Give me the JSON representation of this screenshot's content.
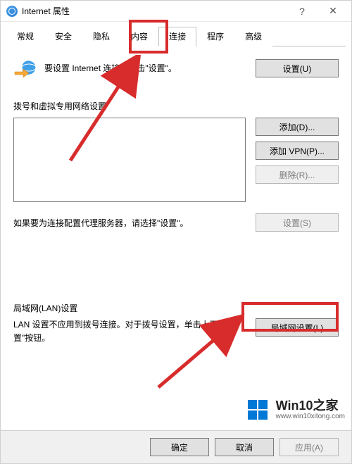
{
  "window": {
    "title": "Internet 属性",
    "help_label": "?",
    "close_label": "✕"
  },
  "tabs": {
    "items": [
      "常规",
      "安全",
      "隐私",
      "内容",
      "连接",
      "程序",
      "高级"
    ],
    "active_index": 4
  },
  "top": {
    "desc_pre": "要设置 Internet 连接，单击",
    "desc_quoted": "\"设置\"",
    "desc_post": "。",
    "settings_btn": "设置(U)"
  },
  "dial": {
    "title": "拨号和虚拟专用网络设置",
    "add_btn": "添加(D)...",
    "add_vpn_btn": "添加 VPN(P)...",
    "remove_btn": "删除(R)...",
    "proxy_text": "如果要为连接配置代理服务器，请选择\"设置\"。",
    "proxy_settings_btn": "设置(S)"
  },
  "lan": {
    "title": "局域网(LAN)设置",
    "text": "LAN 设置不应用到拨号连接。对于拨号设置，单击上面的\"设置\"按钮。",
    "btn": "局域网设置(L)"
  },
  "bottom": {
    "ok": "确定",
    "cancel": "取消",
    "apply": "应用(A)"
  },
  "watermark": {
    "brand": "Win10之家",
    "url": "www.win10xitong.com"
  }
}
